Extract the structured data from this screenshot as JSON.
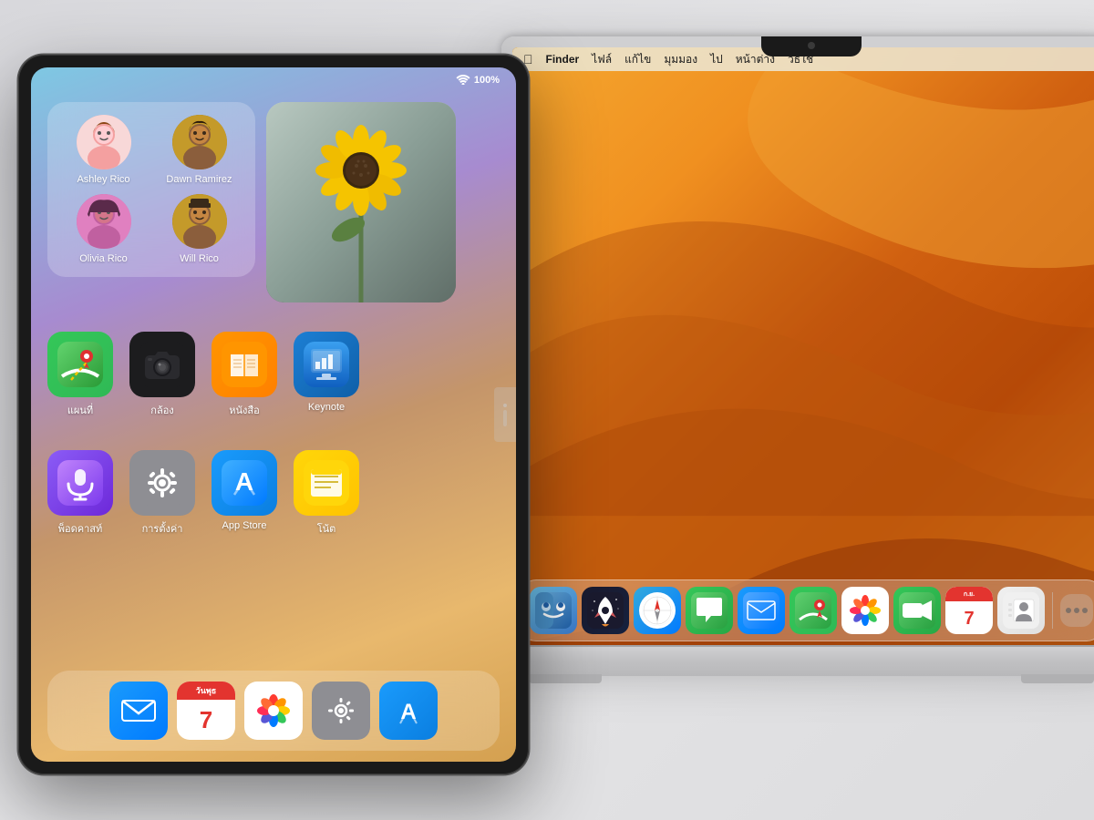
{
  "background": {
    "color": "#e8e8ea"
  },
  "ipad": {
    "status": {
      "wifi": "📶",
      "battery": "100%"
    },
    "contacts_widget": {
      "people": [
        {
          "name": "Ashley Rico",
          "emoji": "🧑",
          "color1": "#f4a0a0",
          "color2": "#f8d0d0"
        },
        {
          "name": "Dawn Ramirez",
          "emoji": "🧑",
          "color1": "#8B6914",
          "color2": "#c49a2a"
        },
        {
          "name": "Olivia Rico",
          "emoji": "👩",
          "color1": "#c060a0",
          "color2": "#e080c0"
        },
        {
          "name": "Will Rico",
          "emoji": "🧑",
          "color1": "#8B6914",
          "color2": "#c49a2a"
        }
      ]
    },
    "app_row1": [
      {
        "label": "แผนที่",
        "type": "maps"
      },
      {
        "label": "กล้อง",
        "type": "camera"
      },
      {
        "label": "หนังสือ",
        "type": "books"
      },
      {
        "label": "Keynote",
        "type": "keynote"
      }
    ],
    "app_row2": [
      {
        "label": "พ็อดคาสท์",
        "type": "podcasts"
      },
      {
        "label": "การตั้งค่า",
        "type": "settings"
      },
      {
        "label": "App Store",
        "type": "appstore"
      },
      {
        "label": "โน้ต",
        "type": "notes"
      }
    ],
    "dock": [
      {
        "type": "mail",
        "label": "Mail"
      },
      {
        "type": "calendar",
        "label": "Calendar",
        "date": "7"
      },
      {
        "type": "photos",
        "label": "Photos"
      },
      {
        "type": "settings",
        "label": "Settings"
      },
      {
        "type": "appstore2",
        "label": "App Store"
      }
    ]
  },
  "macbook": {
    "menubar": {
      "apple": "🍎",
      "items": [
        "Finder",
        "ไฟล์",
        "แก้ไข",
        "มุมมอง",
        "ไป",
        "หน้าต่าง",
        "วิธีใช้"
      ]
    },
    "dock": [
      {
        "type": "finder",
        "label": "Finder"
      },
      {
        "type": "launchpad",
        "label": "Launchpad"
      },
      {
        "type": "safari",
        "label": "Safari"
      },
      {
        "type": "messages",
        "label": "Messages"
      },
      {
        "type": "mail",
        "label": "Mail"
      },
      {
        "type": "maps",
        "label": "Maps"
      },
      {
        "type": "photos",
        "label": "Photos"
      },
      {
        "type": "facetime",
        "label": "FaceTime"
      },
      {
        "type": "calendar",
        "label": "Calendar",
        "date": "7"
      },
      {
        "type": "contacts",
        "label": "Contacts"
      }
    ]
  }
}
